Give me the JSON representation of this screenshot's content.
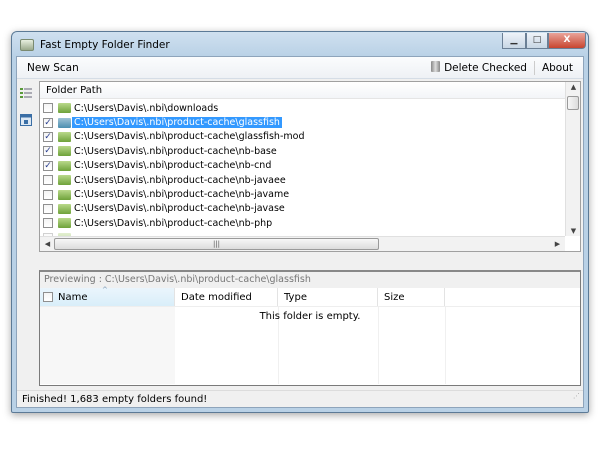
{
  "window": {
    "title": "Fast Empty Folder Finder",
    "minimize": "▁",
    "maximize": "□",
    "close": "X"
  },
  "menu": {
    "new_scan": "New Scan",
    "delete_checked": "Delete Checked",
    "about": "About"
  },
  "folder_list": {
    "header": "Folder Path",
    "rows": [
      {
        "path": "C:\\Users\\Davis\\.nbi\\downloads",
        "checked": false,
        "selected": false
      },
      {
        "path": "C:\\Users\\Davis\\.nbi\\product-cache\\glassfish",
        "checked": true,
        "selected": true
      },
      {
        "path": "C:\\Users\\Davis\\.nbi\\product-cache\\glassfish-mod",
        "checked": true,
        "selected": false
      },
      {
        "path": "C:\\Users\\Davis\\.nbi\\product-cache\\nb-base",
        "checked": true,
        "selected": false
      },
      {
        "path": "C:\\Users\\Davis\\.nbi\\product-cache\\nb-cnd",
        "checked": true,
        "selected": false
      },
      {
        "path": "C:\\Users\\Davis\\.nbi\\product-cache\\nb-javaee",
        "checked": false,
        "selected": false
      },
      {
        "path": "C:\\Users\\Davis\\.nbi\\product-cache\\nb-javame",
        "checked": false,
        "selected": false
      },
      {
        "path": "C:\\Users\\Davis\\.nbi\\product-cache\\nb-javase",
        "checked": false,
        "selected": false
      },
      {
        "path": "C:\\Users\\Davis\\.nbi\\product-cache\\nb-php",
        "checked": false,
        "selected": false
      }
    ]
  },
  "preview": {
    "label": "Previewing : C:\\Users\\Davis\\.nbi\\product-cache\\glassfish",
    "columns": [
      "Name",
      "Date modified",
      "Type",
      "Size"
    ],
    "empty_text": "This folder is empty."
  },
  "status": "Finished! 1,683 empty folders found!",
  "colors": {
    "selection": "#3399ff",
    "folder": "#6ea23a"
  }
}
